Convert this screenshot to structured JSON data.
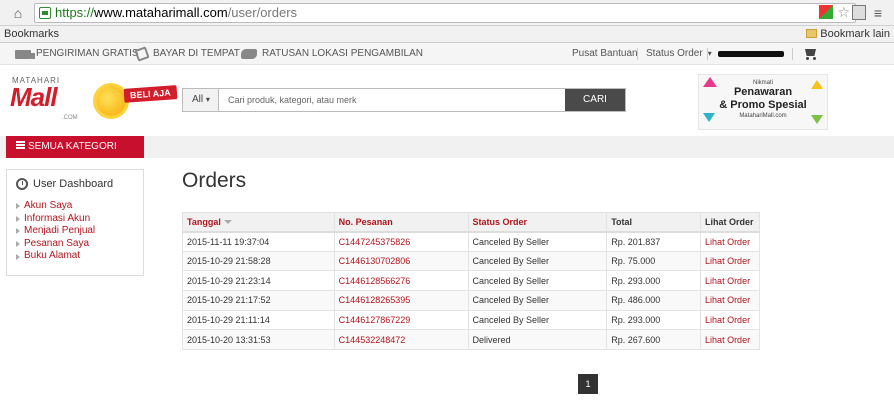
{
  "browser": {
    "url_scheme": "https://",
    "url_host": "www.mataharimall.com",
    "url_path": "/user/orders",
    "bookmarks_label": "Bookmarks",
    "bookmarks_right_label": "Bookmark lain"
  },
  "topnav": {
    "free_shipping": "PENGIRIMAN GRATIS",
    "cod": "BAYAR DI TEMPAT",
    "pickup": "RATUSAN LOKASI PENGAMBILAN",
    "help": "Pusat Bantuan",
    "order_status": "Status Order"
  },
  "header": {
    "logo_top": "MATAHARI",
    "logo_main": "Mall",
    "logo_com": ".COM",
    "logo_badge": "BELI AJA",
    "search_category": "All",
    "search_placeholder": "Cari produk, kategori, atau merk",
    "search_button": "CARI",
    "promo_small": "Nikmati",
    "promo_line1": "Penawaran",
    "promo_line2": "& Promo Spesial",
    "promo_site": "MatahariMall.com"
  },
  "category_button": "SEMUA KATEGORI",
  "sidebar": {
    "title": "User Dashboard",
    "items": [
      {
        "label": "Akun Saya"
      },
      {
        "label": "Informasi Akun"
      },
      {
        "label": "Menjadi Penjual"
      },
      {
        "label": "Pesanan Saya"
      },
      {
        "label": "Buku Alamat"
      }
    ]
  },
  "main": {
    "title": "Orders",
    "columns": [
      "Tanggal",
      "No. Pesanan",
      "Status Order",
      "Total",
      "Lihat Order"
    ],
    "rows": [
      {
        "date": "2015-11-11 19:37:04",
        "order_no": "C1447245375826",
        "status": "Canceled By Seller",
        "total": "Rp. 201.837",
        "view": "Lihat Order"
      },
      {
        "date": "2015-10-29 21:58:28",
        "order_no": "C1446130702806",
        "status": "Canceled By Seller",
        "total": "Rp. 75.000",
        "view": "Lihat Order"
      },
      {
        "date": "2015-10-29 21:23:14",
        "order_no": "C1446128566276",
        "status": "Canceled By Seller",
        "total": "Rp. 293.000",
        "view": "Lihat Order"
      },
      {
        "date": "2015-10-29 21:17:52",
        "order_no": "C1446128265395",
        "status": "Canceled By Seller",
        "total": "Rp. 486.000",
        "view": "Lihat Order"
      },
      {
        "date": "2015-10-29 21:11:14",
        "order_no": "C1446127867229",
        "status": "Canceled By Seller",
        "total": "Rp. 293.000",
        "view": "Lihat Order"
      },
      {
        "date": "2015-10-20 13:31:53",
        "order_no": "C144532248472",
        "status": "Delivered",
        "total": "Rp. 267.600",
        "view": "Lihat Order"
      }
    ],
    "pagination_current": "1"
  }
}
